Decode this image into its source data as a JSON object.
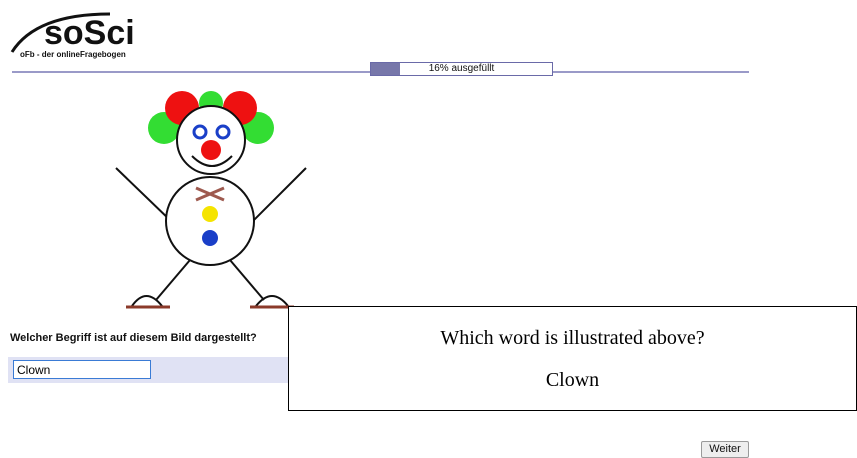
{
  "header": {
    "logo_text": "soSci",
    "logo_subtitle": "oFb - der onlineFragebogen"
  },
  "progress": {
    "percent": 16,
    "label": "16% ausgefüllt"
  },
  "illustration": {
    "icon": "clown-drawing-icon",
    "colors": {
      "hair_green": "#33dd33",
      "hair_red": "#ee1111",
      "eyes": "#1a3fc8",
      "nose": "#ee1111",
      "bowtie": "#9e5a4f",
      "button_yellow": "#f5e400",
      "button_blue": "#1a3fc8",
      "shoes": "#8b3a2a"
    }
  },
  "question": {
    "text": "Welcher Begriff ist auf diesem Bild dargestellt?",
    "answer_value": "Clown"
  },
  "overlay": {
    "question": "Which word is illustrated above?",
    "answer": "Clown"
  },
  "buttons": {
    "next_label": "Weiter"
  }
}
